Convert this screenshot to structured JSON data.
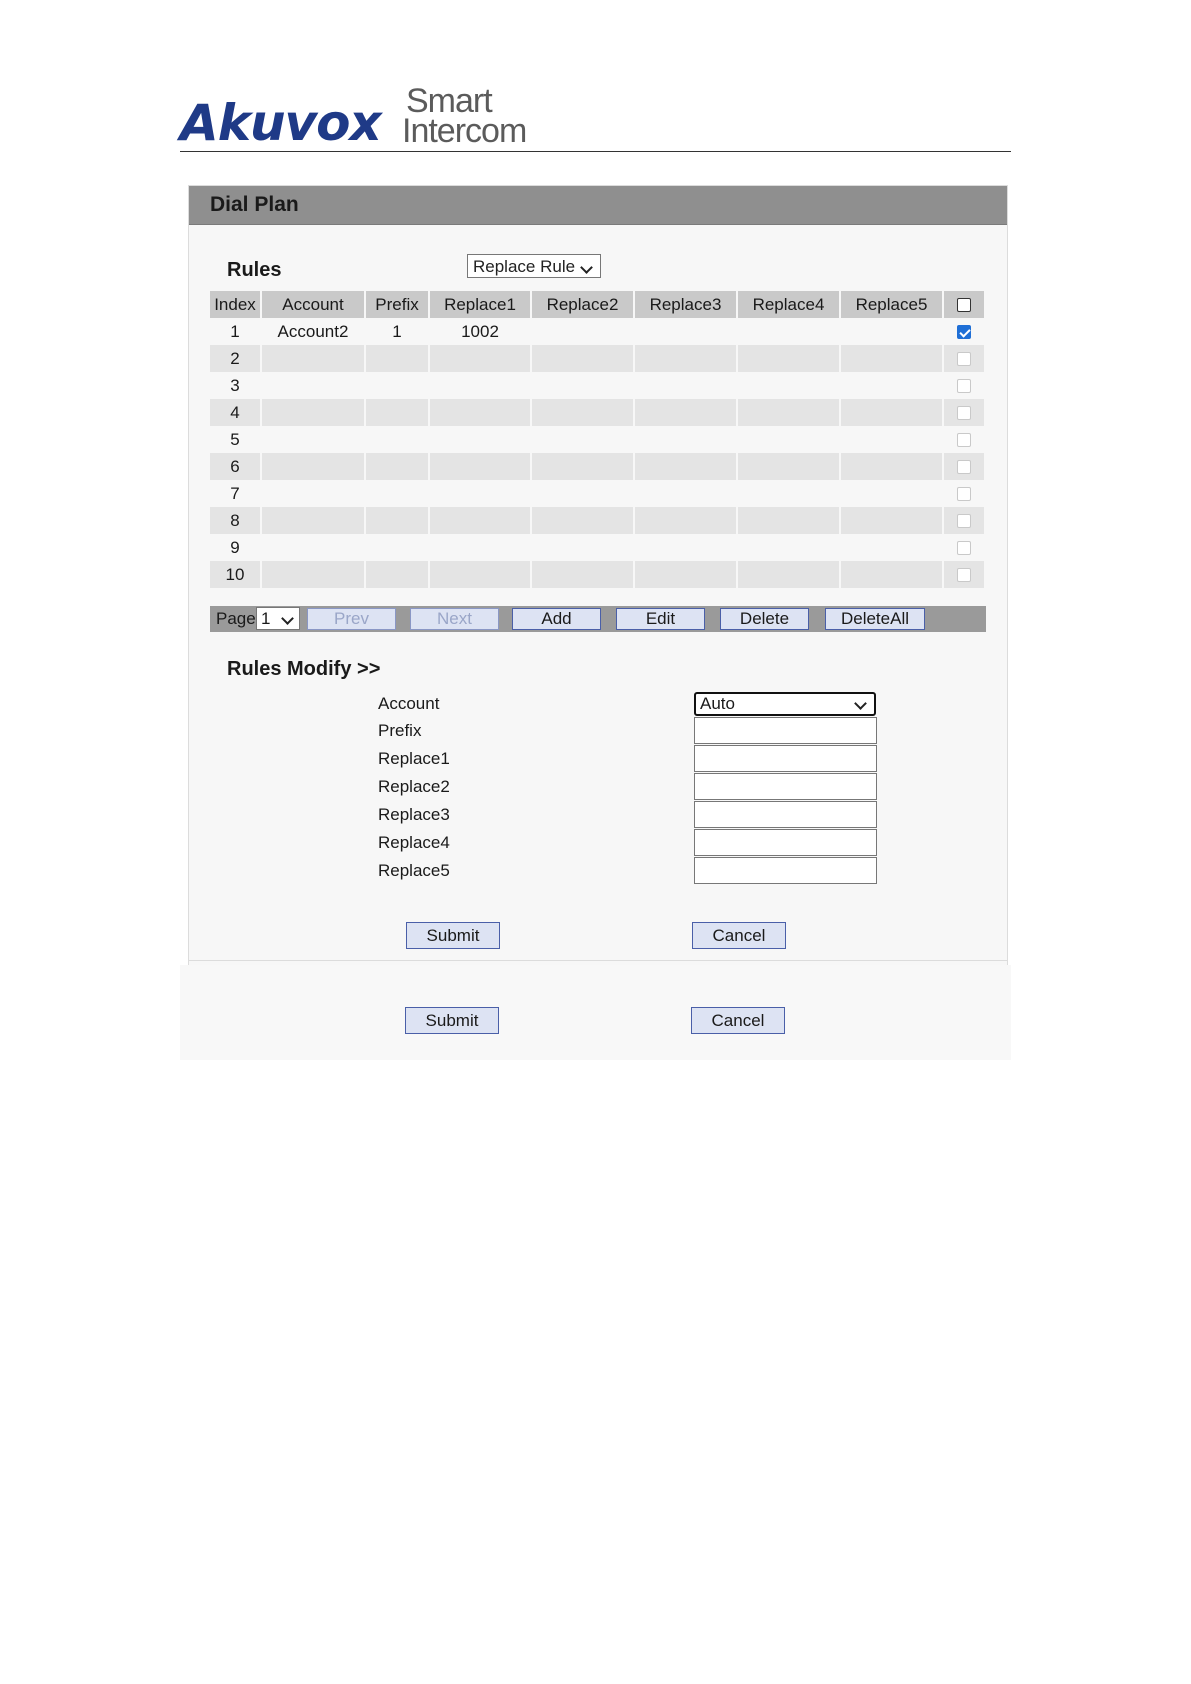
{
  "brand": {
    "name": "Akuvox",
    "tagline_line1": "Smart",
    "tagline_line2": "Intercom"
  },
  "panel": {
    "title": "Dial Plan"
  },
  "rules": {
    "label": "Rules",
    "mode_selected": "Replace Rule",
    "columns": [
      "Index",
      "Account",
      "Prefix",
      "Replace1",
      "Replace2",
      "Replace3",
      "Replace4",
      "Replace5"
    ],
    "rows": [
      {
        "index": "1",
        "account": "Account2",
        "prefix": "1",
        "replace1": "1002",
        "replace2": "",
        "replace3": "",
        "replace4": "",
        "replace5": "",
        "checked": true
      },
      {
        "index": "2",
        "account": "",
        "prefix": "",
        "replace1": "",
        "replace2": "",
        "replace3": "",
        "replace4": "",
        "replace5": "",
        "checked": false
      },
      {
        "index": "3",
        "account": "",
        "prefix": "",
        "replace1": "",
        "replace2": "",
        "replace3": "",
        "replace4": "",
        "replace5": "",
        "checked": false
      },
      {
        "index": "4",
        "account": "",
        "prefix": "",
        "replace1": "",
        "replace2": "",
        "replace3": "",
        "replace4": "",
        "replace5": "",
        "checked": false
      },
      {
        "index": "5",
        "account": "",
        "prefix": "",
        "replace1": "",
        "replace2": "",
        "replace3": "",
        "replace4": "",
        "replace5": "",
        "checked": false
      },
      {
        "index": "6",
        "account": "",
        "prefix": "",
        "replace1": "",
        "replace2": "",
        "replace3": "",
        "replace4": "",
        "replace5": "",
        "checked": false
      },
      {
        "index": "7",
        "account": "",
        "prefix": "",
        "replace1": "",
        "replace2": "",
        "replace3": "",
        "replace4": "",
        "replace5": "",
        "checked": false
      },
      {
        "index": "8",
        "account": "",
        "prefix": "",
        "replace1": "",
        "replace2": "",
        "replace3": "",
        "replace4": "",
        "replace5": "",
        "checked": false
      },
      {
        "index": "9",
        "account": "",
        "prefix": "",
        "replace1": "",
        "replace2": "",
        "replace3": "",
        "replace4": "",
        "replace5": "",
        "checked": false
      },
      {
        "index": "10",
        "account": "",
        "prefix": "",
        "replace1": "",
        "replace2": "",
        "replace3": "",
        "replace4": "",
        "replace5": "",
        "checked": false
      }
    ],
    "pager": {
      "page_label": "Page",
      "page_value": "1",
      "prev": "Prev",
      "next": "Next",
      "add": "Add",
      "edit": "Edit",
      "delete": "Delete",
      "delete_all": "DeleteAll"
    }
  },
  "modify": {
    "label": "Rules Modify >>",
    "account_label": "Account",
    "account_value": "Auto",
    "prefix_label": "Prefix",
    "replace1_label": "Replace1",
    "replace2_label": "Replace2",
    "replace3_label": "Replace3",
    "replace4_label": "Replace4",
    "replace5_label": "Replace5",
    "submit": "Submit",
    "cancel": "Cancel"
  },
  "footer": {
    "submit": "Submit",
    "cancel": "Cancel"
  },
  "colors": {
    "brand_blue": "#1f3a87",
    "header_gray": "#8f8f8f",
    "button_fill": "#dde3f3",
    "checkbox_on": "#1f6fd6"
  }
}
